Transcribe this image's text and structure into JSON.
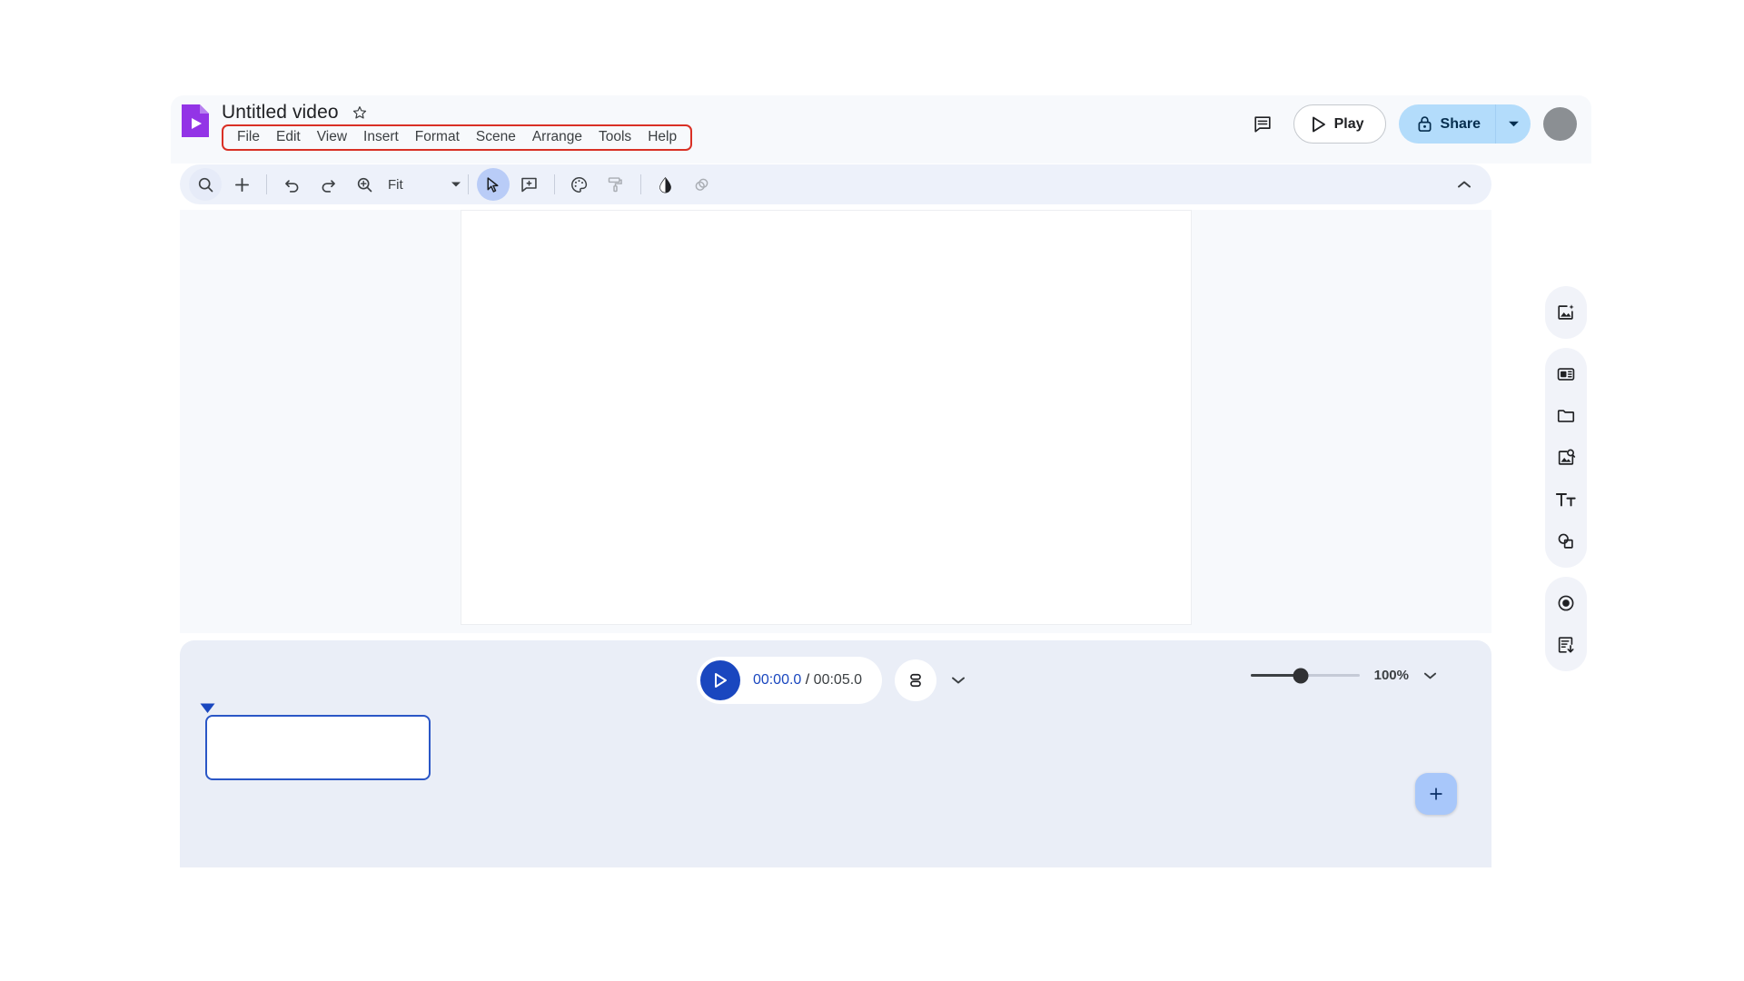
{
  "app": {
    "logo_icon": "vids-logo-icon",
    "title": "Untitled video",
    "star_icon": "star-outline-icon"
  },
  "menubar": {
    "items": [
      {
        "label": "File"
      },
      {
        "label": "Edit"
      },
      {
        "label": "View"
      },
      {
        "label": "Insert"
      },
      {
        "label": "Format"
      },
      {
        "label": "Scene"
      },
      {
        "label": "Arrange"
      },
      {
        "label": "Tools"
      },
      {
        "label": "Help"
      }
    ],
    "highlight_color": "#d93025"
  },
  "header_actions": {
    "comment_icon": "comment-icon",
    "play_label": "Play",
    "play_icon": "play-triangle-icon",
    "share_label": "Share",
    "share_icon": "lock-icon",
    "share_caret_icon": "caret-down-icon",
    "share_color": "#b3dcfb",
    "avatar_color": "#8b8f93"
  },
  "toolbar": {
    "zoom_value": "Fit",
    "collapse_icon": "chevron-up-icon",
    "items": [
      {
        "name": "search-icon"
      },
      {
        "name": "add-icon"
      },
      {
        "name": "undo-icon"
      },
      {
        "name": "redo-icon"
      },
      {
        "name": "zoom-icon"
      },
      {
        "name": "cursor-select-icon"
      },
      {
        "name": "add-comment-icon"
      },
      {
        "name": "palette-icon"
      },
      {
        "name": "paint-format-icon"
      },
      {
        "name": "fill-color-icon"
      },
      {
        "name": "transparency-icon"
      }
    ]
  },
  "rail": {
    "groups": [
      {
        "items": [
          {
            "name": "generate-image-icon"
          }
        ]
      },
      {
        "items": [
          {
            "name": "media-card-icon"
          },
          {
            "name": "folder-icon"
          },
          {
            "name": "stock-media-icon"
          },
          {
            "name": "text-icon"
          },
          {
            "name": "shapes-icon"
          }
        ]
      },
      {
        "items": [
          {
            "name": "record-icon"
          },
          {
            "name": "export-icon"
          }
        ]
      }
    ]
  },
  "timeline": {
    "play_icon": "play-triangle-icon",
    "current_time": "00:00.0",
    "time_separator": " / ",
    "total_time": "00:05.0",
    "layers_icon": "layers-icon",
    "layers_caret_icon": "chevron-down-icon",
    "zoom_percent": "100%",
    "zoom_caret_icon": "chevron-down-icon",
    "slider_position_pct": 46,
    "playhead_icon": "playhead-marker-icon",
    "add_scene_icon": "add-icon",
    "clip": {
      "label": ""
    }
  },
  "colors": {
    "accent_blue": "#1a47bf",
    "clip_border": "#2a56c6",
    "timeline_bg": "#eaeef7",
    "toolbar_bg": "#edf1fa",
    "stage_bg": "#f7f9fc"
  }
}
